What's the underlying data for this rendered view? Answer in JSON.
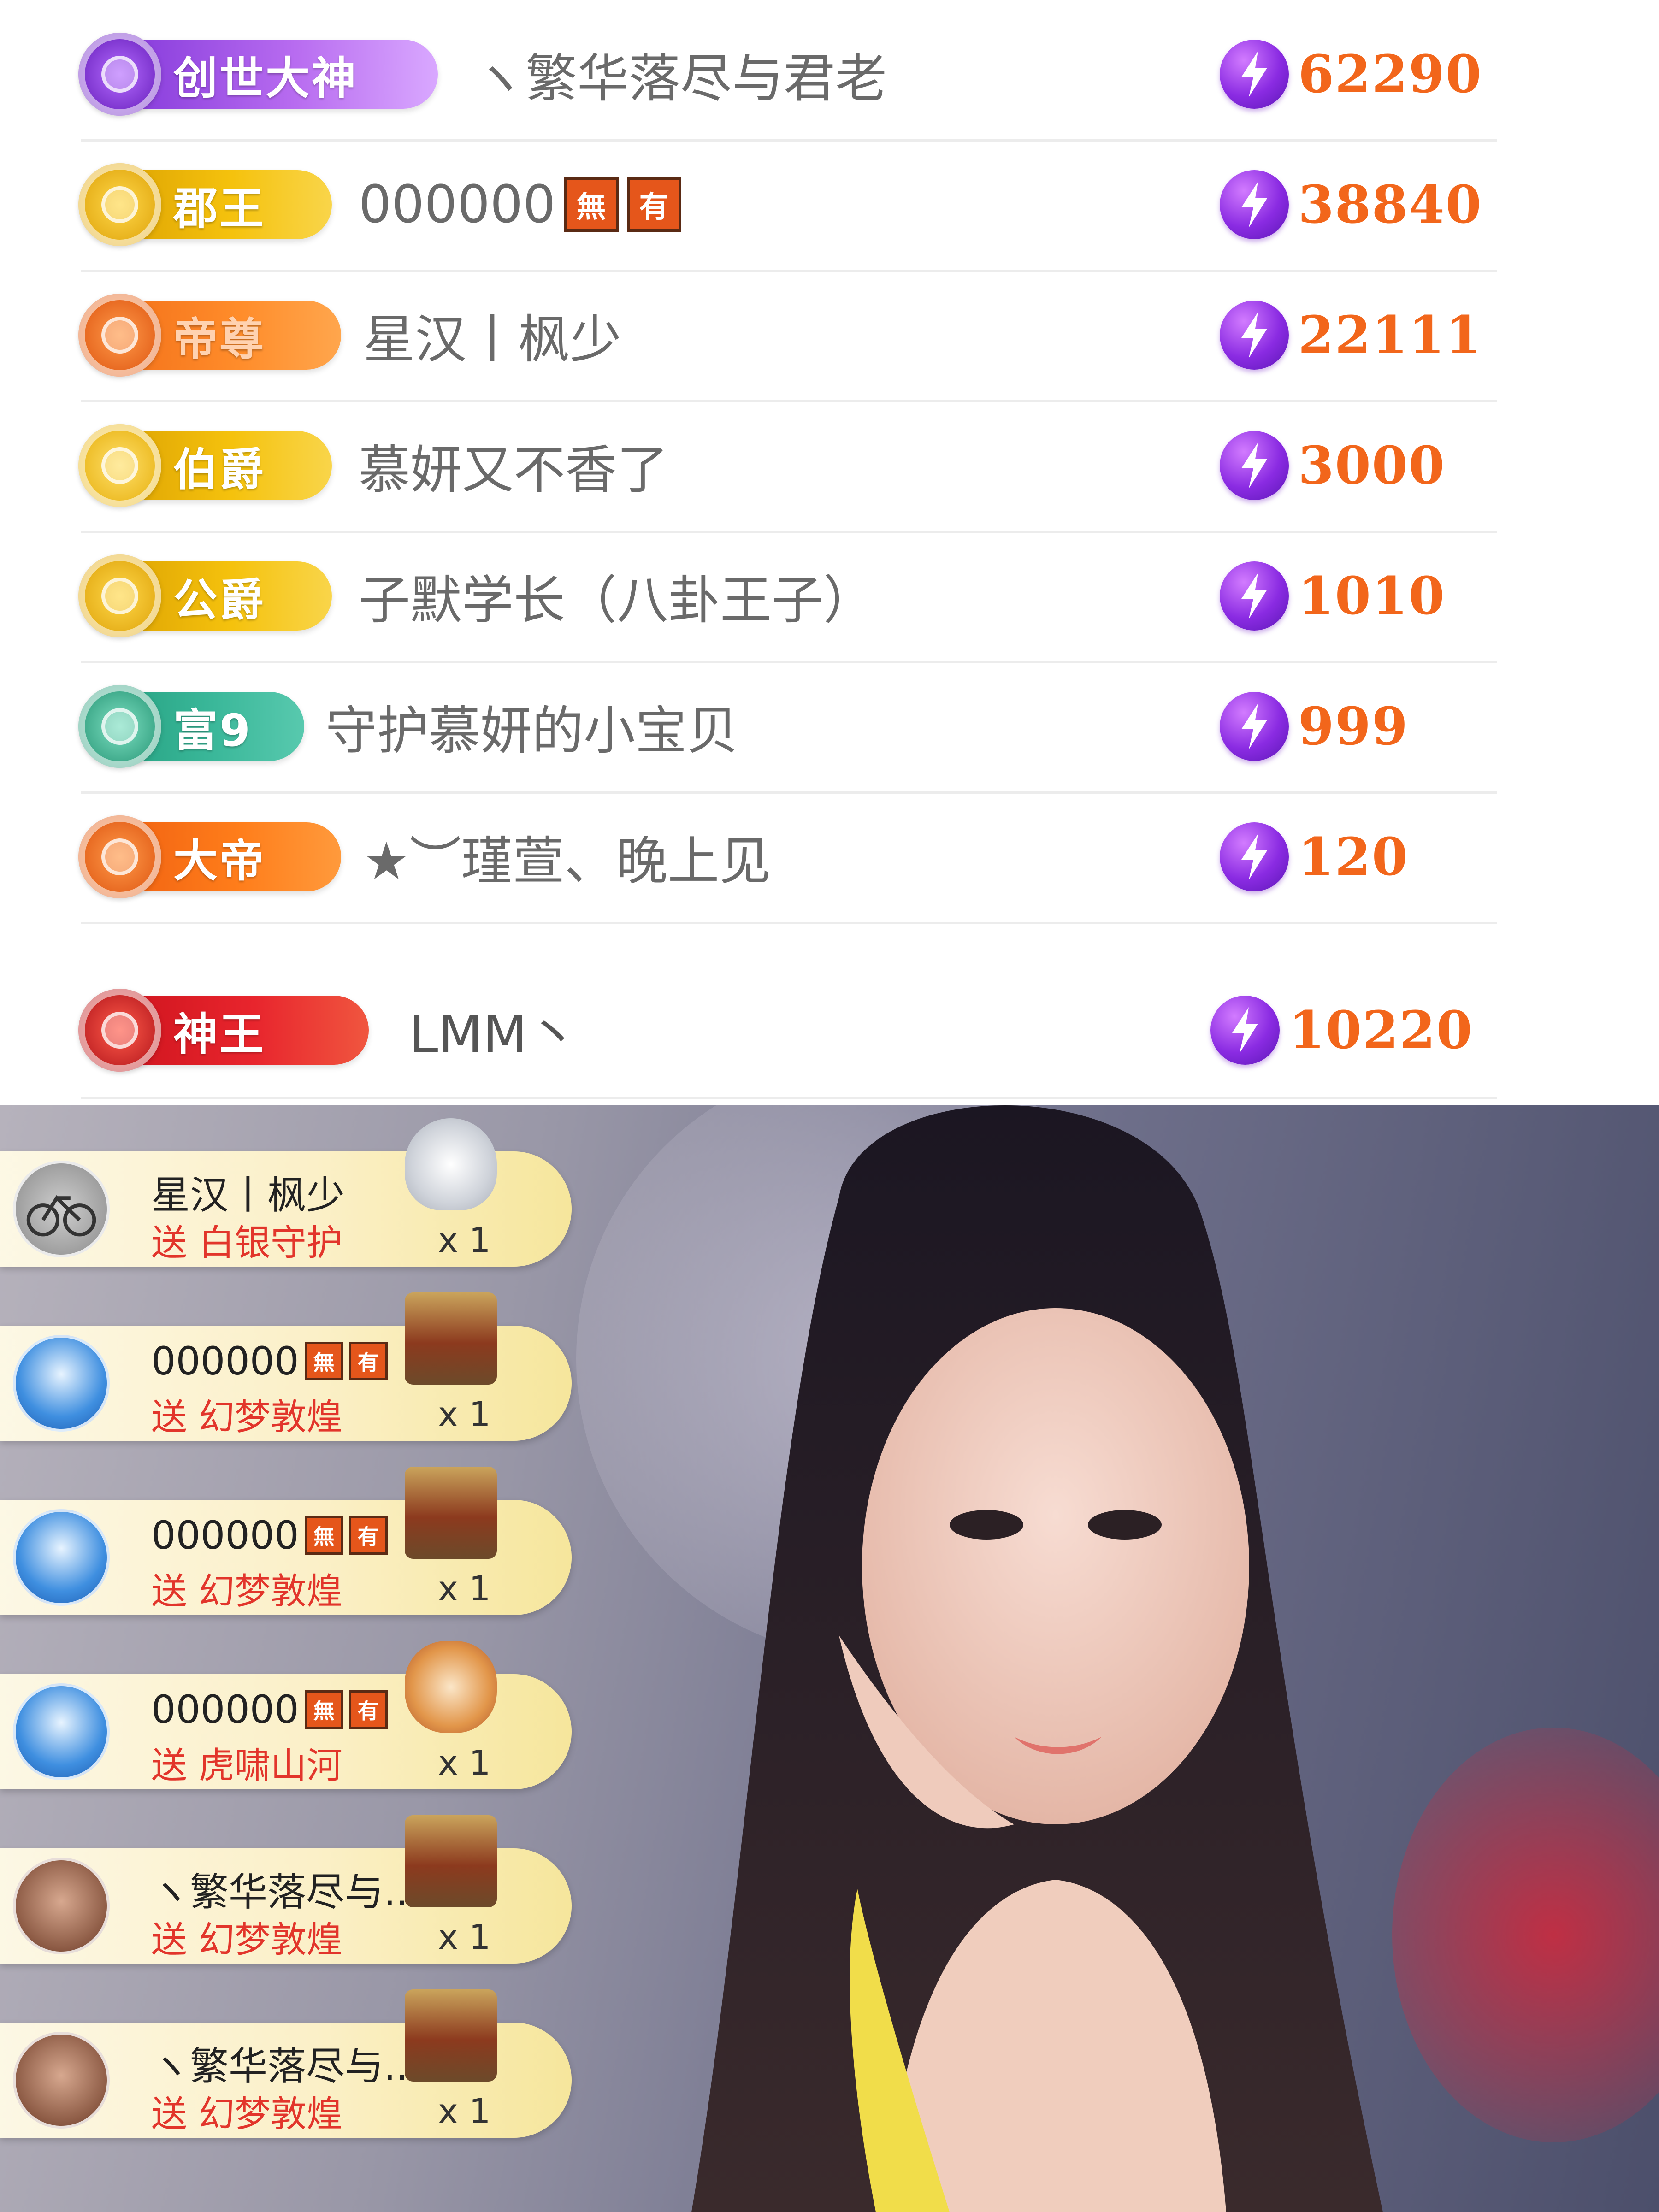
{
  "ranking": {
    "rows": [
      {
        "badge": "创世大神",
        "name": "ヽ繁华落尽与君老",
        "score": "62290",
        "tags": []
      },
      {
        "badge": "郡王",
        "name": "000000",
        "score": "38840",
        "tags": [
          "無",
          "有"
        ]
      },
      {
        "badge": "帝尊",
        "name": "星汉丨枫少",
        "score": "22111",
        "tags": []
      },
      {
        "badge": "伯爵",
        "name": "慕妍又不香了",
        "score": "3000",
        "tags": []
      },
      {
        "badge": "公爵",
        "name": "子默学长（八卦王子）",
        "score": "1010",
        "tags": []
      },
      {
        "badge": "富9",
        "name": "守护慕妍的小宝贝",
        "score": "999",
        "tags": []
      },
      {
        "badge": "大帝",
        "name": "★︶瑾萱、晚上见",
        "score": "120",
        "tags": []
      }
    ],
    "self_row": {
      "badge": "神王",
      "name": "LMM丶",
      "score": "10220"
    }
  },
  "gifts": [
    {
      "user": "星汉丨枫少",
      "tags": [],
      "action": "送",
      "gift": "白银守护",
      "count": "x 1"
    },
    {
      "user": "000000",
      "tags": [
        "無",
        "有"
      ],
      "action": "送",
      "gift": "幻梦敦煌",
      "count": "x 1"
    },
    {
      "user": "000000",
      "tags": [
        "無",
        "有"
      ],
      "action": "送",
      "gift": "幻梦敦煌",
      "count": "x 1"
    },
    {
      "user": "000000",
      "tags": [
        "無",
        "有"
      ],
      "action": "送",
      "gift": "虎啸山河",
      "count": "x 1"
    },
    {
      "user": "ヽ繁华落尽与...",
      "tags": [],
      "action": "送",
      "gift": "幻梦敦煌",
      "count": "x 1"
    },
    {
      "user": "ヽ繁华落尽与...",
      "tags": [],
      "action": "送",
      "gift": "幻梦敦煌",
      "count": "x 1"
    }
  ],
  "colors": {
    "score": "#f2661b",
    "gift_text": "#e2352b",
    "bolt_icon": "#8a2be2"
  }
}
